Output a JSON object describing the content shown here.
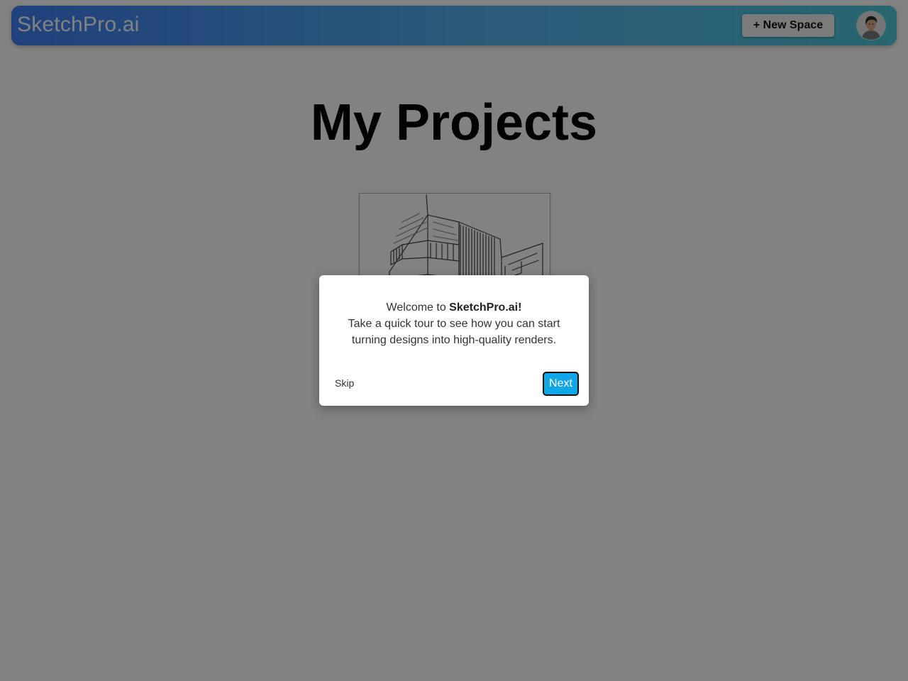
{
  "header": {
    "brand": "SketchPro.ai",
    "new_space_label": "+ New Space",
    "avatar_icon": "user-avatar-icon"
  },
  "main": {
    "title": "My Projects",
    "projects": [
      {
        "thumbnail_icon": "building-sketch-image"
      }
    ]
  },
  "tour_dialog": {
    "welcome_prefix": "Welcome to ",
    "welcome_brand": "SketchPro.ai!",
    "message_line1": "Take a quick tour to see how you can start",
    "message_line2": "turning designs into high-quality renders.",
    "skip_label": "Skip",
    "next_label": "Next"
  },
  "colors": {
    "header_gradient_start": "#3f80f6",
    "header_gradient_end": "#4fc8dc",
    "overlay": "#000000",
    "next_button": "#11a6e8"
  }
}
